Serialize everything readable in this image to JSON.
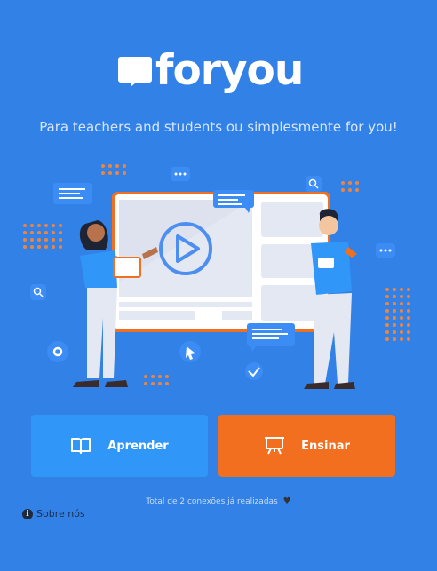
{
  "brand": {
    "name": "foryou",
    "tagline": "Para teachers and students ou simplesmente for you!"
  },
  "actions": {
    "learn_label": "Aprender",
    "teach_label": "Ensinar"
  },
  "footer": {
    "connections_text": "Total de 2 conexões já realizadas",
    "about_label": "Sobre nós"
  },
  "icons": {
    "logo": "chat-bubble-icon",
    "learn": "book-icon",
    "teach": "presentation-board-icon",
    "heart": "heart-icon",
    "about": "info-icon"
  },
  "colors": {
    "background": "#3181e7",
    "learn_button": "#3096f7",
    "teach_button": "#f26f20",
    "accent_orange": "#f26f20"
  }
}
